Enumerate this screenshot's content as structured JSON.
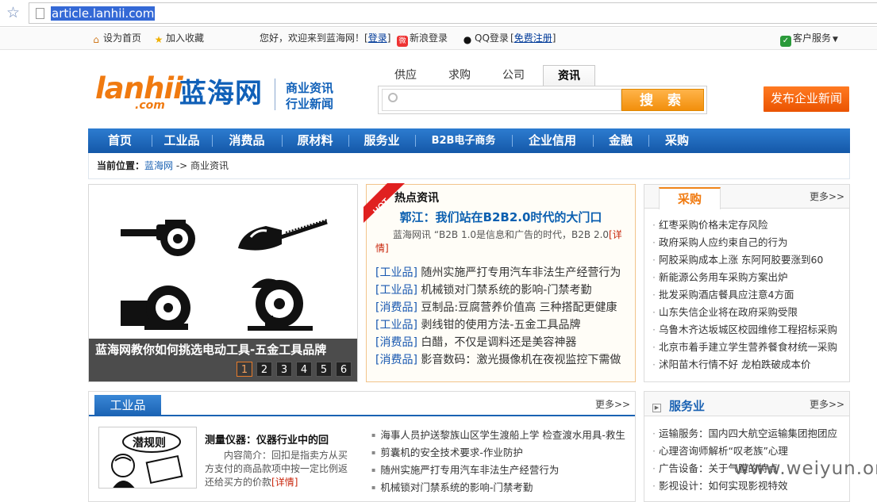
{
  "browser": {
    "url": "article.lanhii.com"
  },
  "topbar": {
    "set_home": "设为首页",
    "add_fav": "加入收藏",
    "welcome": "您好，欢迎来到蓝海网！[",
    "login": "登录",
    "close1": "]",
    "sina_login": "新浪登录",
    "qq_login": "QQ登录",
    "open2": "[",
    "register": "免费注册",
    "close2": "]",
    "service": "客户服务"
  },
  "header": {
    "logo_en": "lanhii",
    "logo_com": ".com",
    "logo_cn": "蓝海网",
    "sub1": "商业资讯",
    "sub2": "行业新闻",
    "search_tabs": [
      "供应",
      "求购",
      "公司",
      "资讯"
    ],
    "search_button": "搜 索",
    "publish_button": "发布企业新闻"
  },
  "nav": [
    "首页",
    "工业品",
    "消费品",
    "原材料",
    "服务业",
    "B2B电子商务",
    "企业信用",
    "金融",
    "采购"
  ],
  "breadcrumb": {
    "label": "当前位置：",
    "home": "蓝海网",
    "sep": " -> ",
    "current": "商业资讯"
  },
  "slider": {
    "caption": "蓝海网教你如何挑选电动工具-五金工具品牌",
    "pages": [
      "1",
      "2",
      "3",
      "4",
      "5",
      "6"
    ]
  },
  "hot": {
    "badge": "HOT",
    "title": "热点资讯",
    "headline": "郭江：我们站在B2B2.0时代的大门口",
    "summary": "蓝海网讯 “B2B 1.0是信息和广告的时代，B2B 2.0",
    "detail": "[详情]",
    "items": [
      {
        "cat": "[工业品]",
        "text": "随州实施严打专用汽车非法生产经营行为"
      },
      {
        "cat": "[工业品]",
        "text": "机械锁对门禁系统的影响-门禁考勤"
      },
      {
        "cat": "[消费品]",
        "text": "豆制品:豆腐营养价值高 三种搭配更健康"
      },
      {
        "cat": "[工业品]",
        "text": "剥线钳的使用方法-五金工具品牌"
      },
      {
        "cat": "[消费品]",
        "text": "白醋，不仅是调料还是美容神器"
      },
      {
        "cat": "[消费品]",
        "text": "影音数码：激光摄像机在夜视监控下需做"
      }
    ]
  },
  "caigou": {
    "title": "采购",
    "more": "更多>>",
    "items": [
      "红枣采购价格未定存风险",
      "政府采购人应约束自己的行为",
      "阿胶采购成本上涨 东阿阿胶要涨到60",
      "新能源公务用车采购方案出炉",
      "批发采购酒店餐具应注意4方面",
      "山东失信企业将在政府采购受限",
      "乌鲁木齐达坂城区校园维修工程招标采购",
      "北京市着手建立学生营养餐食材统一采购",
      "沭阳苗木行情不好 龙柏跌破成本价"
    ]
  },
  "gongyepin": {
    "title": "工业品",
    "more": "更多>>",
    "img_text": "潜规则",
    "feature_title": "测量仪器：仪器行业中的回",
    "feature_desc": "内容简介：回扣是指卖方从买方支付的商品款项中按一定比例返还给买方的价款",
    "detail": "[详情]",
    "items": [
      "海事人员护送黎族山区学生渡船上学 检查渡水用具-救生",
      "剪囊机的安全技术要求-作业防护",
      "随州实施严打专用汽车非法生产经营行为",
      "机械锁对门禁系统的影响-门禁考勤"
    ]
  },
  "fuwuye": {
    "title": "服务业",
    "more": "更多>>",
    "items": [
      "运输服务：国内四大航空运输集团抱团应",
      "心理咨询师解析“叹老族”心理",
      "广告设备：关于气膜的特点",
      "影视设计：如何实现影视特效"
    ]
  },
  "watermark": "www.weiyun.org"
}
